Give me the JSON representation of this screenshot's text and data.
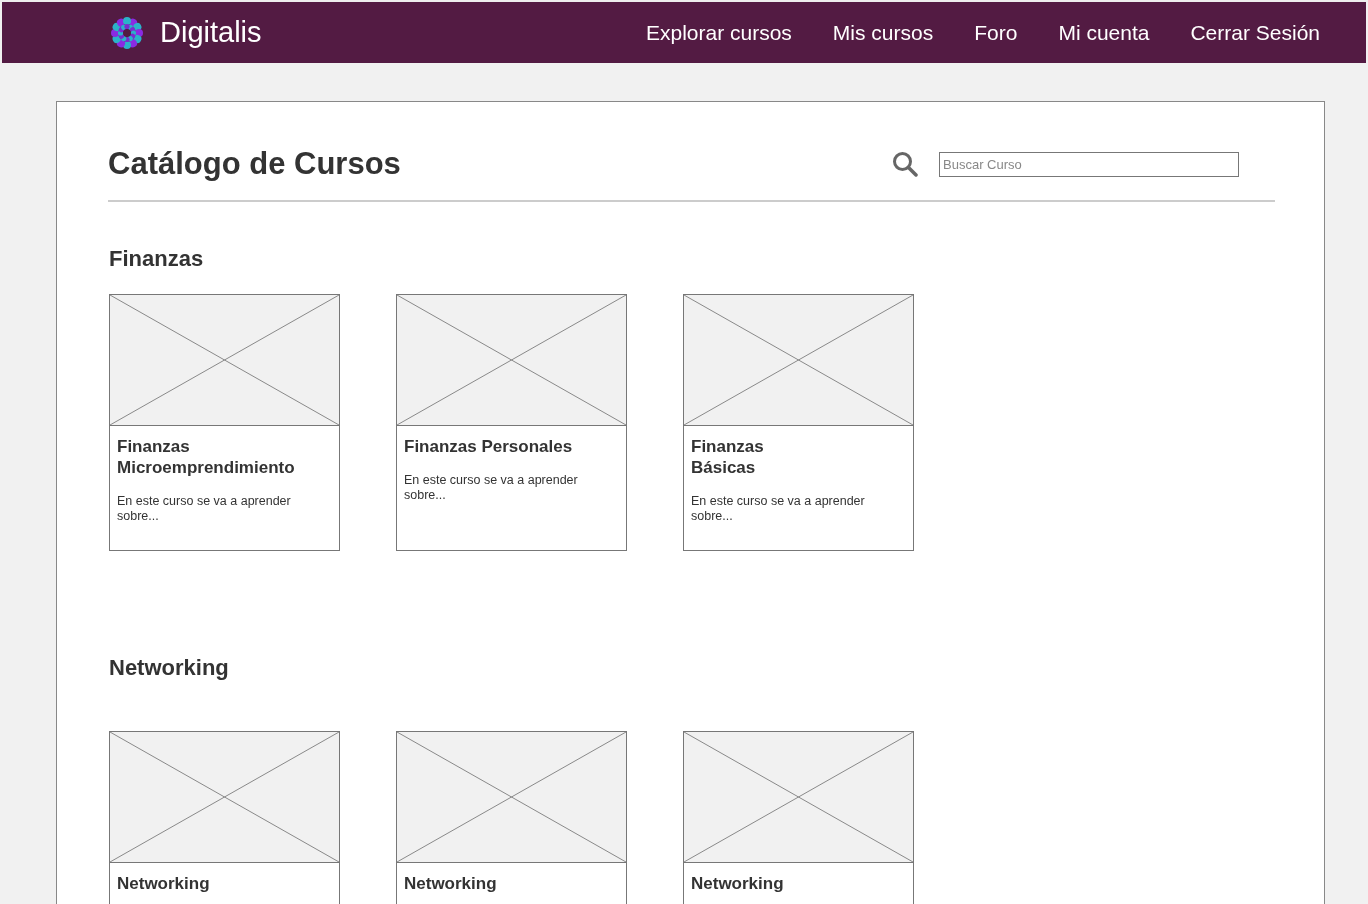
{
  "brand": {
    "name": "Digitalis"
  },
  "nav": [
    {
      "label": "Explorar cursos"
    },
    {
      "label": "Mis cursos"
    },
    {
      "label": "Foro"
    },
    {
      "label": "Mi cuenta"
    },
    {
      "label": "Cerrar Sesión"
    }
  ],
  "catalog": {
    "title": "Catálogo de Cursos",
    "search": {
      "placeholder": "Buscar Curso"
    }
  },
  "sections": [
    {
      "title": "Finanzas",
      "courses": [
        {
          "title_lines": [
            "Finanzas",
            "Microemprendimiento"
          ],
          "description": "En este curso se va a aprender sobre..."
        },
        {
          "title_lines": [
            "Finanzas Personales"
          ],
          "description": "En este curso se va a aprender sobre..."
        },
        {
          "title_lines": [
            "Finanzas",
            "Básicas"
          ],
          "description": "En este curso se va a aprender sobre..."
        }
      ]
    },
    {
      "title": "Networking",
      "courses": [
        {
          "title_lines": [
            "Networking"
          ]
        },
        {
          "title_lines": [
            "Networking"
          ]
        },
        {
          "title_lines": [
            "Networking"
          ]
        }
      ]
    }
  ]
}
